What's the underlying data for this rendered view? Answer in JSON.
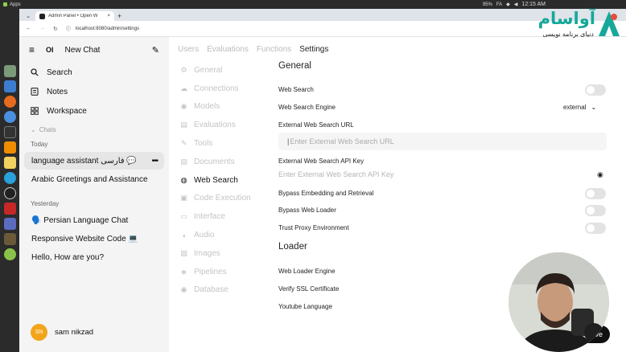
{
  "os": {
    "apps_label": "Apps",
    "lang": "FA",
    "kbd": "95%",
    "clock": "12:15 AM"
  },
  "browser": {
    "tab_title": "Admin Panel • Open W",
    "url": "localhost:8080/admin/settings"
  },
  "sidebar": {
    "logo": "OI",
    "new_chat": "New Chat",
    "items": [
      {
        "label": "Search",
        "icon": "search-icon"
      },
      {
        "label": "Notes",
        "icon": "notes-icon"
      },
      {
        "label": "Workspace",
        "icon": "workspace-icon"
      }
    ],
    "chats_label": "Chats",
    "groups": [
      {
        "label": "Today",
        "chats": [
          "language assistant فارسی 💬",
          "Arabic Greetings and Assistance"
        ]
      },
      {
        "label": "Yesterday",
        "chats": [
          "🗣️ Persian Language Chat",
          "Responsive Website Code 💻",
          "Hello, How are you?"
        ]
      }
    ],
    "user": {
      "initials": "SN",
      "name": "sam nikzad"
    }
  },
  "admin_tabs": [
    "Users",
    "Evaluations",
    "Functions",
    "Settings"
  ],
  "settings_nav": [
    {
      "label": "General",
      "icon": "gear-icon"
    },
    {
      "label": "Connections",
      "icon": "cloud-icon"
    },
    {
      "label": "Models",
      "icon": "database-icon"
    },
    {
      "label": "Evaluations",
      "icon": "document-icon"
    },
    {
      "label": "Tools",
      "icon": "wrench-icon"
    },
    {
      "label": "Documents",
      "icon": "document-icon"
    },
    {
      "label": "Web Search",
      "icon": "globe-icon"
    },
    {
      "label": "Code Execution",
      "icon": "code-icon"
    },
    {
      "label": "Interface",
      "icon": "monitor-icon"
    },
    {
      "label": "Audio",
      "icon": "audio-icon"
    },
    {
      "label": "Images",
      "icon": "image-icon"
    },
    {
      "label": "Pipelines",
      "icon": "pipeline-icon"
    },
    {
      "label": "Database",
      "icon": "database-icon"
    }
  ],
  "settings": {
    "general_heading": "General",
    "web_search_label": "Web Search",
    "engine_label": "Web Search Engine",
    "engine_value": "external",
    "url_label": "External Web Search URL",
    "url_placeholder": "Enter External Web Search URL",
    "api_key_label": "External Web Search API Key",
    "api_key_placeholder": "Enter External Web Search API Key",
    "bypass_embedding_label": "Bypass Embedding and Retrieval",
    "bypass_loader_label": "Bypass Web Loader",
    "trust_proxy_label": "Trust Proxy Environment",
    "loader_heading": "Loader",
    "loader_engine_label": "Web Loader Engine",
    "verify_ssl_label": "Verify SSL Certificate",
    "youtube_label": "Youtube Language",
    "save_label": "Save"
  },
  "brand": {
    "word": "آواسام",
    "tagline": "دنیای برنامه نویسی"
  }
}
